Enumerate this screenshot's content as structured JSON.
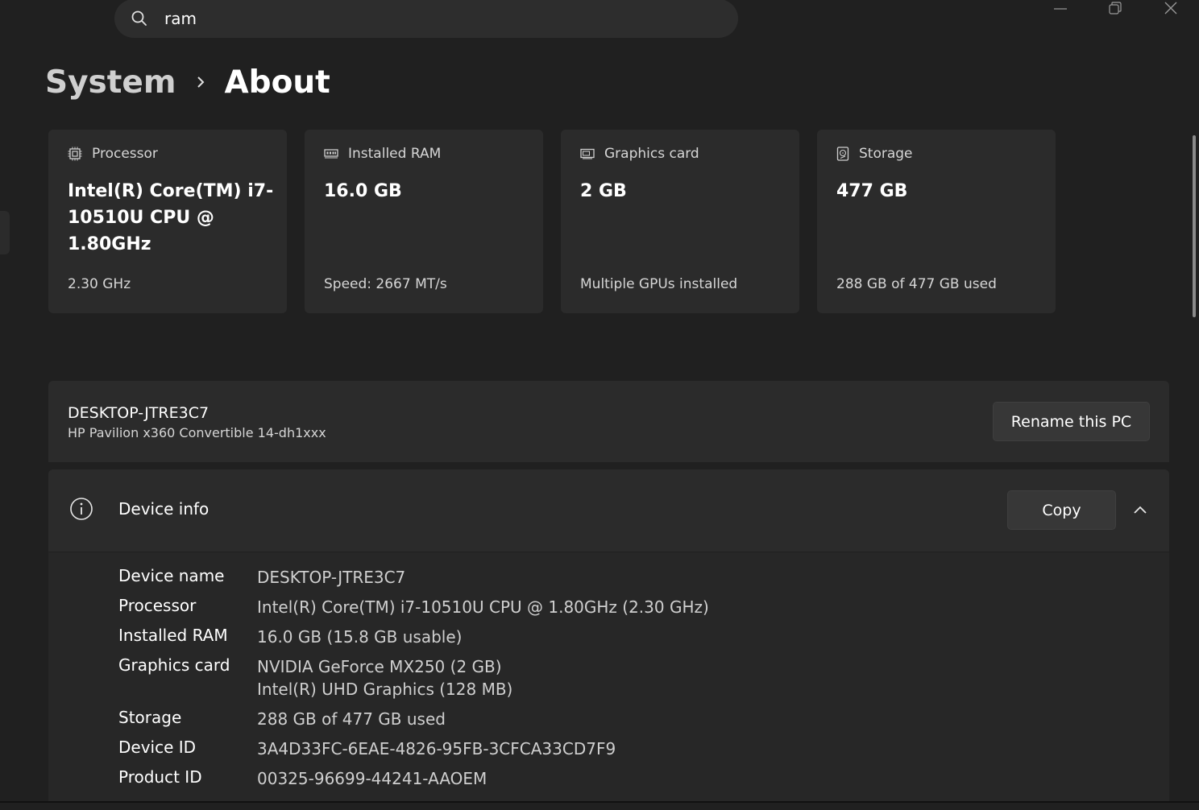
{
  "search": {
    "value": "ram"
  },
  "breadcrumb": {
    "parent": "System",
    "current": "About"
  },
  "specs": [
    {
      "icon": "processor-icon",
      "label": "Processor",
      "value": "Intel(R) Core(TM) i7-10510U CPU @ 1.80GHz",
      "sub": "2.30 GHz"
    },
    {
      "icon": "ram-icon",
      "label": "Installed RAM",
      "value": "16.0 GB",
      "sub": "Speed: 2667 MT/s"
    },
    {
      "icon": "graphics-card-icon",
      "label": "Graphics card",
      "value": "2 GB",
      "sub": "Multiple GPUs installed"
    },
    {
      "icon": "storage-icon",
      "label": "Storage",
      "value": "477 GB",
      "sub": "288 GB of 477 GB used"
    }
  ],
  "pc": {
    "name": "DESKTOP-JTRE3C7",
    "model": "HP Pavilion x360 Convertible 14-dh1xxx",
    "rename_label": "Rename this PC"
  },
  "device_info": {
    "title": "Device info",
    "copy_label": "Copy",
    "rows": [
      {
        "key": "Device name",
        "value": "DESKTOP-JTRE3C7"
      },
      {
        "key": "Processor",
        "value": "Intel(R) Core(TM) i7-10510U CPU @ 1.80GHz (2.30 GHz)"
      },
      {
        "key": "Installed RAM",
        "value": "16.0 GB (15.8 GB usable)"
      },
      {
        "key": "Graphics card",
        "value": "NVIDIA GeForce MX250 (2 GB)",
        "value2": "Intel(R) UHD Graphics (128 MB)"
      },
      {
        "key": "Storage",
        "value": "288 GB of 477 GB used"
      },
      {
        "key": "Device ID",
        "value": "3A4D33FC-6EAE-4826-95FB-3CFCA33CD7F9"
      },
      {
        "key": "Product ID",
        "value": "00325-96699-44241-AAOEM"
      }
    ]
  },
  "colors": {
    "background": "#202020",
    "card": "#2b2b2b",
    "text": "#ffffff",
    "secondary_text": "#cfcfcf"
  }
}
